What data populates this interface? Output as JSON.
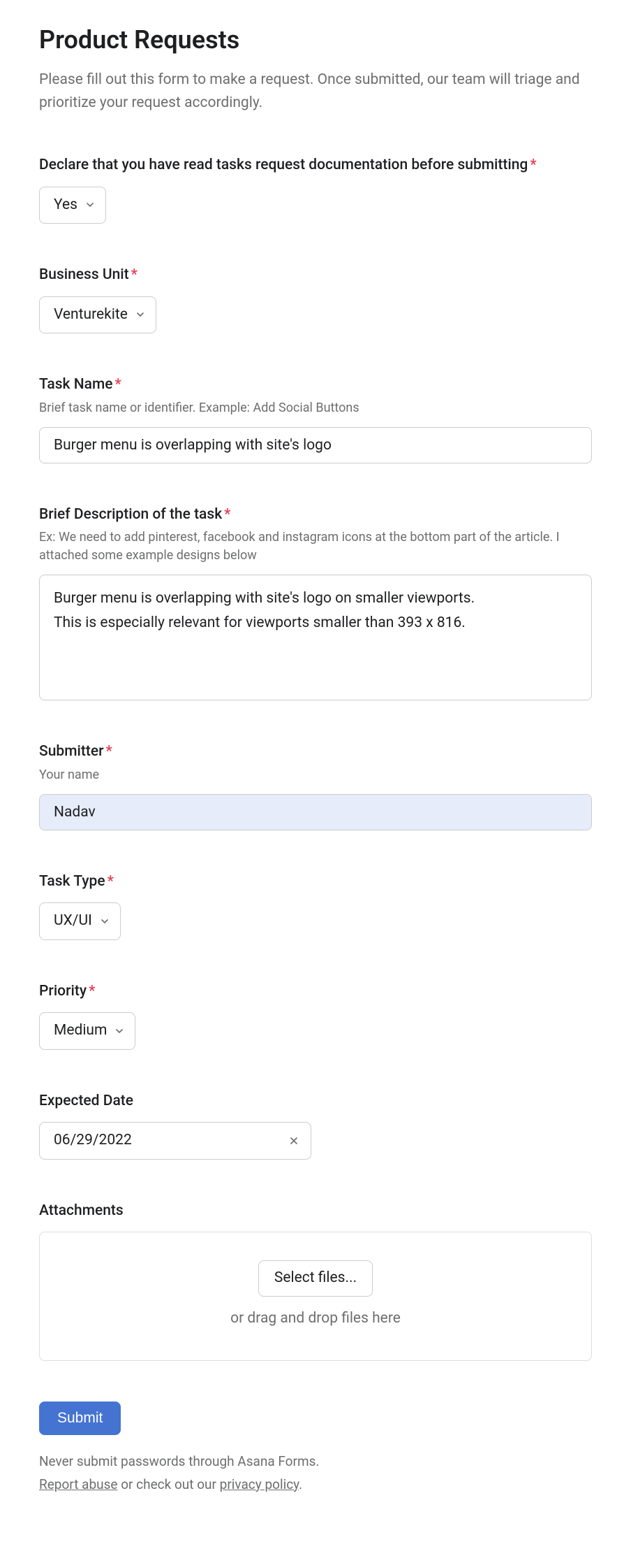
{
  "header": {
    "title": "Product Requests",
    "subtitle": "Please fill out this form to make a request. Once submitted, our team will triage and prioritize your request accordingly."
  },
  "fields": {
    "declare": {
      "label": "Declare that you have read tasks request documentation before submitting",
      "value": "Yes"
    },
    "business_unit": {
      "label": "Business Unit",
      "value": "Venturekite"
    },
    "task_name": {
      "label": "Task Name",
      "hint": "Brief task name or identifier. Example: Add Social Buttons",
      "value": "Burger menu is overlapping with site's logo"
    },
    "description": {
      "label": "Brief Description of the task",
      "hint": "Ex: We need to add pinterest, facebook and instagram icons at the bottom part of the article. I attached some example designs below",
      "value": "Burger menu is overlapping with site's logo on smaller viewports.\nThis is especially relevant for viewports smaller than 393 x 816."
    },
    "submitter": {
      "label": "Submitter",
      "hint": "Your name",
      "value": "Nadav"
    },
    "task_type": {
      "label": "Task Type",
      "value": "UX/UI"
    },
    "priority": {
      "label": "Priority",
      "value": "Medium"
    },
    "expected_date": {
      "label": "Expected Date",
      "value": "06/29/2022"
    },
    "attachments": {
      "label": "Attachments",
      "button": "Select files...",
      "hint": "or drag and drop files here"
    }
  },
  "submit": {
    "label": "Submit"
  },
  "footer": {
    "line1": "Never submit passwords through Asana Forms.",
    "report": "Report abuse",
    "mid": " or check out our ",
    "privacy": "privacy policy",
    "end": "."
  },
  "symbols": {
    "asterisk": "*"
  }
}
